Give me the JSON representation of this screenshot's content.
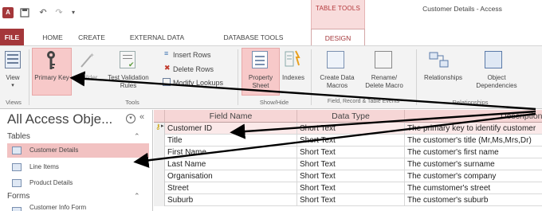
{
  "app": {
    "window_title": "Customer Details - Access",
    "contextual_group": "TABLE TOOLS",
    "app_icon_text": "A"
  },
  "ribbon_tabs": {
    "file": "FILE",
    "home": "HOME",
    "create": "CREATE",
    "external": "EXTERNAL DATA",
    "dbtools": "DATABASE TOOLS",
    "design": "DESIGN"
  },
  "ribbon": {
    "view": "View",
    "primary_key": "Primary Key",
    "builder": "Builder",
    "test_validation": "Test Validation Rules",
    "insert_rows": "Insert Rows",
    "delete_rows": "Delete Rows",
    "modify_lookups": "Modify Lookups",
    "property_sheet": "Property Sheet",
    "indexes": "Indexes",
    "create_data_macros": "Create Data Macros",
    "rename_delete_macro": "Rename/ Delete Macro",
    "relationships": "Relationships",
    "object_dependencies": "Object Dependencies",
    "groups": {
      "views": "Views",
      "tools": "Tools",
      "show_hide": "Show/Hide",
      "field_events": "Field, Record & Table Events",
      "relationships": "Relationships"
    }
  },
  "nav": {
    "title": "All Access Obje...",
    "tables_section": "Tables",
    "items": [
      "Customer Details",
      "Line Items",
      "Product Details"
    ],
    "forms_section": "Forms",
    "partial_item": "Customer Info Form"
  },
  "grid": {
    "headers": [
      "Field Name",
      "Data Type",
      "Description"
    ],
    "rows": [
      {
        "name": "Customer ID",
        "type": "Short Text",
        "desc": "The primary key to identify customer"
      },
      {
        "name": "Title",
        "type": "Short Text",
        "desc": "The customer's title (Mr,Ms,Mrs,Dr)"
      },
      {
        "name": "First Name",
        "type": "Short Text",
        "desc": "The customer's first name"
      },
      {
        "name": "Last Name",
        "type": "Short Text",
        "desc": "The customer's surname"
      },
      {
        "name": "Organisation",
        "type": "Short Text",
        "desc": "The customer's company"
      },
      {
        "name": "Street",
        "type": "Short Text",
        "desc": "The cumstomer's street"
      },
      {
        "name": "Suburb",
        "type": "Short Text",
        "desc": "The customer's suburb"
      }
    ]
  },
  "colors": {
    "accent": "#a4373a",
    "highlight": "#f7c9c9",
    "header_bg": "#f6d6d6"
  }
}
